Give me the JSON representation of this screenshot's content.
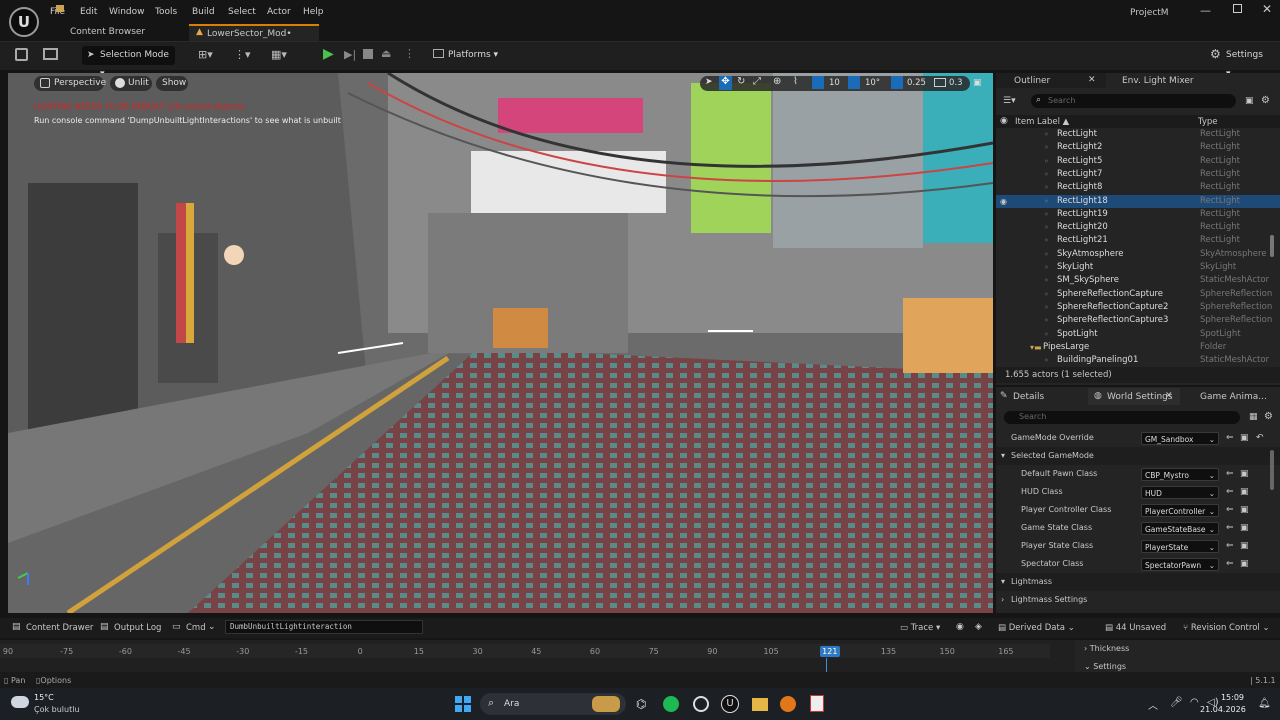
{
  "app": {
    "project": "ProjectM",
    "logo": "unreal-logo"
  },
  "menu": [
    "File",
    "Edit",
    "Window",
    "Tools",
    "Build",
    "Select",
    "Actor",
    "Help"
  ],
  "tabs": {
    "content_browser": "Content Browser",
    "level": "LowerSector_Mod•"
  },
  "toolbar": {
    "mode": "Selection Mode",
    "platforms": "Platforms",
    "settings": "Settings"
  },
  "viewport": {
    "perspective": "Perspective",
    "unlit": "Unlit",
    "show": "Show",
    "grid_snap": "10",
    "rot_snap": "10°",
    "scale_snap": "0.25",
    "cam_speed": "0.3",
    "warning": "LIGHTING NEEDS TO BE REBUILT (28 unbuilt objects)",
    "hint": "Run console command 'DumpUnbuiltLightInteractions' to see what is unbuilt"
  },
  "outliner": {
    "tab": "Outliner",
    "tab2": "Env. Light Mixer",
    "search_placeholder": "Search",
    "col_label": "Item Label ▲",
    "col_type": "Type",
    "rows": [
      {
        "label": "RectLight",
        "type": "RectLight"
      },
      {
        "label": "RectLight2",
        "type": "RectLight"
      },
      {
        "label": "RectLight5",
        "type": "RectLight"
      },
      {
        "label": "RectLight7",
        "type": "RectLight"
      },
      {
        "label": "RectLight8",
        "type": "RectLight"
      },
      {
        "label": "RectLight18",
        "type": "RectLight"
      },
      {
        "label": "RectLight19",
        "type": "RectLight"
      },
      {
        "label": "RectLight20",
        "type": "RectLight"
      },
      {
        "label": "RectLight21",
        "type": "RectLight"
      },
      {
        "label": "SkyAtmosphere",
        "type": "SkyAtmosphere"
      },
      {
        "label": "SkyLight",
        "type": "SkyLight"
      },
      {
        "label": "SM_SkySphere",
        "type": "StaticMeshActor"
      },
      {
        "label": "SphereReflectionCapture",
        "type": "SphereReflection"
      },
      {
        "label": "SphereReflectionCapture2",
        "type": "SphereReflection"
      },
      {
        "label": "SphereReflectionCapture3",
        "type": "SphereReflection"
      },
      {
        "label": "SpotLight",
        "type": "SpotLight"
      },
      {
        "label": "PipesLarge",
        "type": "Folder"
      },
      {
        "label": "BuildingPaneling01",
        "type": "StaticMeshActor"
      }
    ],
    "selected_index": 5,
    "footer": "1.655 actors (1 selected)"
  },
  "details": {
    "tab": "Details",
    "tab2": "World Settings",
    "tab3": "Game Anima...",
    "search_placeholder": "Search",
    "gamemode_override": {
      "label": "GameMode Override",
      "value": "GM_Sandbox"
    },
    "section_selected": "Selected GameMode",
    "props": [
      {
        "label": "Default Pawn Class",
        "value": "CBP_Mystro"
      },
      {
        "label": "HUD Class",
        "value": "HUD"
      },
      {
        "label": "Player Controller Class",
        "value": "PlayerController"
      },
      {
        "label": "Game State Class",
        "value": "GameStateBase"
      },
      {
        "label": "Player State Class",
        "value": "PlayerState"
      },
      {
        "label": "Spectator Class",
        "value": "SpectatorPawn"
      }
    ],
    "section_lightmass": "Lightmass",
    "lightmass_settings": "Lightmass Settings"
  },
  "bottom": {
    "content_drawer": "Content Drawer",
    "output_log": "Output Log",
    "cmd": "Cmd",
    "cmd_value": "DumbUnbuiltLightinteraction",
    "trace": "Trace",
    "derived": "Derived Data",
    "unsaved": "44 Unsaved",
    "revision": "Revision Control"
  },
  "timeline": {
    "ticks": [
      "90",
      "-75",
      "-60",
      "-45",
      "-30",
      "-15",
      "0",
      "15",
      "30",
      "45",
      "60",
      "75",
      "90",
      "105",
      "121",
      "135",
      "150",
      "165"
    ],
    "current": "121",
    "thickness": "Thickness",
    "settings": "Settings"
  },
  "status": {
    "pan": "Pan",
    "options": "Options",
    "version": "5.1.1"
  },
  "taskbar": {
    "temp": "15°C",
    "weather": "Çok bulutlu",
    "search": "Ara",
    "time": "15:09",
    "date": "21.04.2026"
  }
}
